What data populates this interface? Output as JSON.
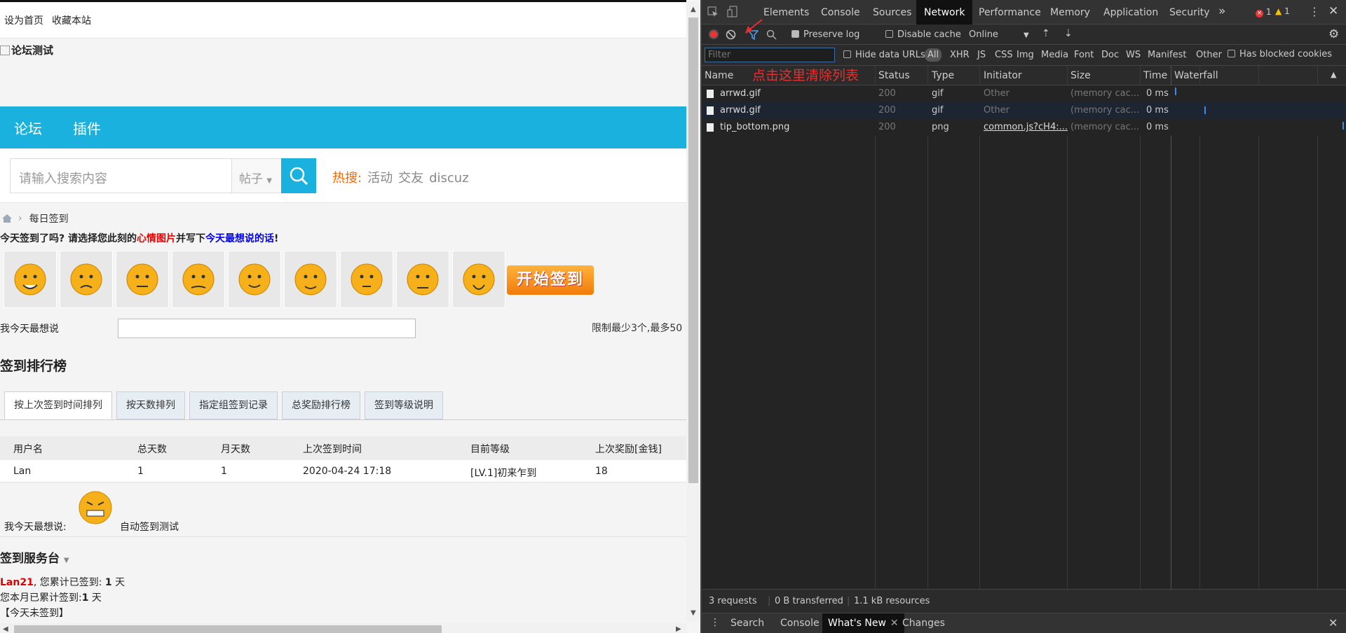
{
  "page": {
    "topbar": [
      "设为首页",
      "收藏本站"
    ],
    "logo_alt": "论坛测试",
    "nav": [
      "论坛",
      "插件"
    ],
    "search": {
      "placeholder": "请输入搜索内容",
      "type": "帖子",
      "hot_label": "热搜:",
      "hot_words": [
        "活动",
        "交友",
        "discuz"
      ]
    },
    "breadcrumb": "每日签到",
    "question": {
      "p1": "今天签到了吗? 请选择您此刻的",
      "p2": "心情图片",
      "p3": "并写下",
      "p4": "今天最想说的话",
      "p5": "!"
    },
    "start_button": "开始签到",
    "say_label": "我今天最想说",
    "limit_text": "限制最少3个,最多50",
    "rank_title": "签到排行榜",
    "tabs": [
      "按上次签到时间排列",
      "按天数排列",
      "指定组签到记录",
      "总奖励排行榜",
      "签到等级说明"
    ],
    "table": {
      "headers": [
        "用户名",
        "总天数",
        "月天数",
        "上次签到时间",
        "目前等级",
        "上次奖励[金钱]"
      ],
      "rows": [
        [
          "Lan",
          "1",
          "1",
          "2020-04-24 17:18",
          "[LV.1]初来乍到",
          "18"
        ]
      ]
    },
    "mood": {
      "label": "我今天最想说:",
      "text": "自动签到测试"
    },
    "service_title": "签到服务台",
    "stats": {
      "user": "Lan21",
      "line1": ", 您累计已签到: ",
      "days_total": "1",
      "unit": " 天",
      "line2": "您本月已累计签到:",
      "days_month": "1",
      "line3": "【今天未签到】"
    }
  },
  "devtools": {
    "tabs": [
      "Elements",
      "Console",
      "Sources",
      "Network",
      "Performance",
      "Memory",
      "Application",
      "Security"
    ],
    "errors": "1",
    "warnings": "1",
    "preserve_log": "Preserve log",
    "disable_cache": "Disable cache",
    "throttle": "Online",
    "filter_placeholder": "Filter",
    "hide_data_urls": "Hide data URLs",
    "types": [
      "All",
      "XHR",
      "JS",
      "CSS",
      "Img",
      "Media",
      "Font",
      "Doc",
      "WS",
      "Manifest",
      "Other"
    ],
    "blocked": "Has blocked cookies",
    "annotation": "点击这里清除列表",
    "columns": [
      "Name",
      "Status",
      "Type",
      "Initiator",
      "Size",
      "Time",
      "Waterfall"
    ],
    "rows": [
      {
        "name": "arrwd.gif",
        "status": "200",
        "type": "gif",
        "initiator": "Other",
        "size": "(memory cac...",
        "time": "0 ms"
      },
      {
        "name": "arrwd.gif",
        "status": "200",
        "type": "gif",
        "initiator": "Other",
        "size": "(memory cac...",
        "time": "0 ms"
      },
      {
        "name": "tip_bottom.png",
        "status": "200",
        "type": "png",
        "initiator": "common.js?cH4:...",
        "size": "(memory cac...",
        "time": "0 ms"
      }
    ],
    "summary": {
      "requests": "3 requests",
      "transferred": "0 B transferred",
      "resources": "1.1 kB resources"
    },
    "drawer_tabs": [
      "Search",
      "Console",
      "What's New",
      "Changes"
    ]
  },
  "colors": {
    "brand": "#1ab1de",
    "orange": "#f07b0a",
    "red_note": "#e53030"
  },
  "icons": [
    "search-icon",
    "home-icon",
    "record-icon",
    "clear-icon",
    "filter-icon",
    "upload-icon",
    "download-icon",
    "gear-icon",
    "close-icon"
  ]
}
